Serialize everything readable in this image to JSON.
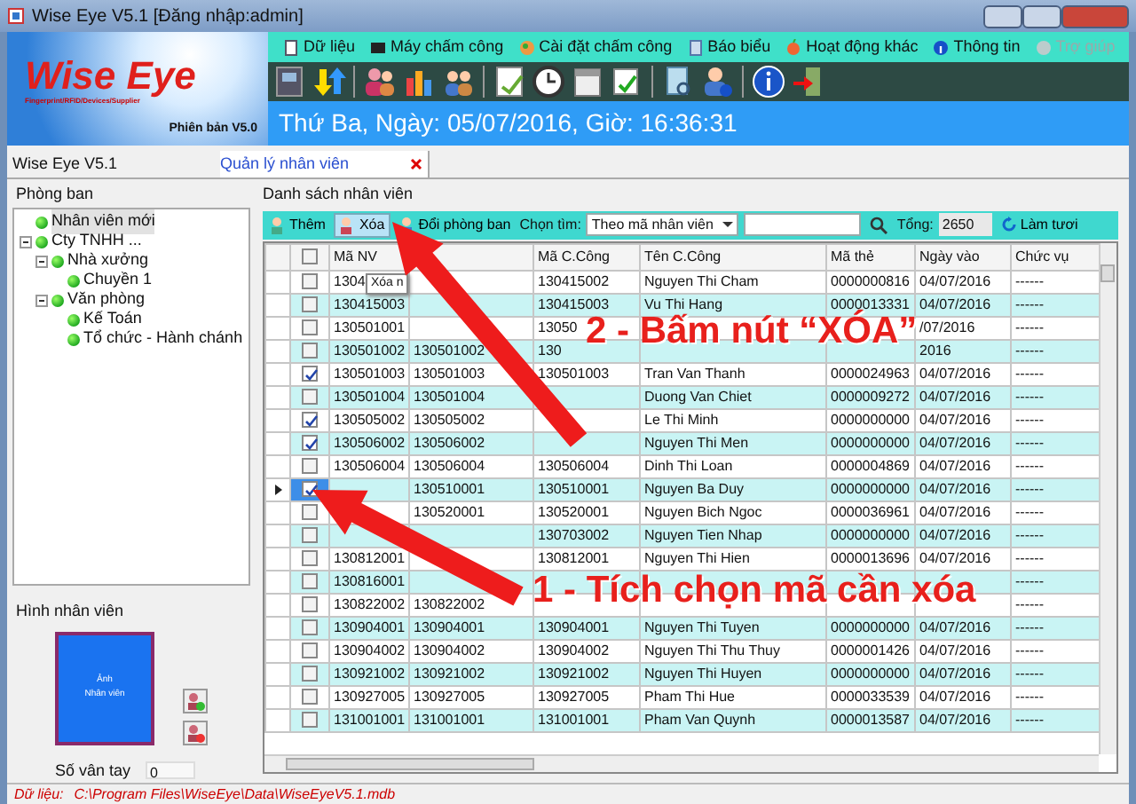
{
  "window": {
    "title": "Wise Eye V5.1 [Đăng nhập:admin]"
  },
  "logo": {
    "name": "Wise Eye",
    "tagline": "Fingerprint/RFID/Devices/Supplier",
    "version": "Phiên bản V5.0"
  },
  "menu": [
    {
      "label": "Dữ liệu",
      "disabled": false
    },
    {
      "label": "Máy chấm công",
      "disabled": false
    },
    {
      "label": "Cài đặt chấm công",
      "disabled": false
    },
    {
      "label": "Báo biểu",
      "disabled": false
    },
    {
      "label": "Hoạt động khác",
      "disabled": false
    },
    {
      "label": "Thông tin",
      "disabled": false
    },
    {
      "label": "Trợ giúp",
      "disabled": true
    }
  ],
  "date_bar": "Thứ Ba, Ngày: 05/07/2016, Giờ: 16:36:31",
  "app_label": "Wise Eye V5.1",
  "tabs": [
    {
      "label": "Quản lý nhân viên",
      "selected": true
    }
  ],
  "departments": {
    "title": "Phòng ban",
    "tree": [
      {
        "label": "Nhân viên mới",
        "selected": true
      },
      {
        "label": "Cty TNHH ...",
        "selected": false,
        "expanded": true,
        "children": [
          {
            "label": "Nhà xưởng",
            "selected": false,
            "expanded": true,
            "children": [
              {
                "label": "Chuyền 1",
                "selected": false
              }
            ]
          },
          {
            "label": "Văn phòng",
            "selected": false,
            "expanded": true,
            "children": [
              {
                "label": "Kế Toán",
                "selected": false
              },
              {
                "label": "Tổ chức - Hành chánh",
                "selected": false
              }
            ]
          }
        ]
      }
    ]
  },
  "photo": {
    "title": "Hình nhân viên",
    "caption": "Ảnh",
    "subcaption": "Nhân viên"
  },
  "fingerprints": {
    "label": "Số vân tay",
    "value": "0"
  },
  "list": {
    "title": "Danh sách nhân viên",
    "toolbar": {
      "add": "Thêm",
      "delete": "Xóa",
      "change_dept": "Đổi phòng ban",
      "search_label": "Chọn tìm:",
      "search_by": "Theo mã nhân viên",
      "total_label": "Tổng:",
      "total": "2650",
      "refresh": "Làm tươi"
    },
    "tooltip": "Xóa n",
    "select_all": false,
    "columns": [
      "Mã NV",
      null,
      "Mã C.Công",
      "Tên C.Công",
      "Mã thẻ",
      "Ngày vào",
      "Chức vụ"
    ],
    "rows": [
      {
        "cells": [
          "1304",
          null,
          "130415002",
          "Nguyen Thi Cham",
          "0000000816",
          "04/07/2016",
          "------"
        ],
        "checked": false,
        "current": false
      },
      {
        "cells": [
          "130415003",
          null,
          "130415003",
          "Vu Thi Hang",
          "0000013331",
          "04/07/2016",
          "------"
        ],
        "checked": false,
        "current": false
      },
      {
        "cells": [
          "130501001",
          null,
          "13050",
          null,
          null,
          "/07/2016",
          "------"
        ],
        "checked": false,
        "current": false
      },
      {
        "cells": [
          "130501002",
          "130501002",
          "130",
          null,
          null,
          "2016",
          "------"
        ],
        "checked": false,
        "current": false
      },
      {
        "cells": [
          "130501003",
          "130501003",
          "130501003",
          "Tran Van Thanh",
          "0000024963",
          "04/07/2016",
          "------"
        ],
        "checked": true,
        "current": false
      },
      {
        "cells": [
          "130501004",
          "130501004",
          null,
          "Duong Van Chiet",
          "0000009272",
          "04/07/2016",
          "------"
        ],
        "checked": false,
        "current": false
      },
      {
        "cells": [
          "130505002",
          "130505002",
          null,
          "Le Thi Minh",
          "0000000000",
          "04/07/2016",
          "------"
        ],
        "checked": true,
        "current": false
      },
      {
        "cells": [
          "130506002",
          "130506002",
          null,
          "Nguyen Thi Men",
          "0000000000",
          "04/07/2016",
          "------"
        ],
        "checked": true,
        "current": false
      },
      {
        "cells": [
          "130506004",
          "130506004",
          "130506004",
          "Dinh Thi Loan",
          "0000004869",
          "04/07/2016",
          "------"
        ],
        "checked": false,
        "current": false
      },
      {
        "cells": [
          null,
          "130510001",
          "130510001",
          "Nguyen Ba Duy",
          "0000000000",
          "04/07/2016",
          "------"
        ],
        "checked": true,
        "current": true
      },
      {
        "cells": [
          null,
          "130520001",
          "130520001",
          "Nguyen Bich Ngoc",
          "0000036961",
          "04/07/2016",
          "------"
        ],
        "checked": false,
        "current": false
      },
      {
        "cells": [
          null,
          null,
          "130703002",
          "Nguyen Tien Nhap",
          "0000000000",
          "04/07/2016",
          "------"
        ],
        "checked": false,
        "current": false
      },
      {
        "cells": [
          "130812001",
          null,
          "130812001",
          "Nguyen Thi Hien",
          "0000013696",
          "04/07/2016",
          "------"
        ],
        "checked": false,
        "current": false
      },
      {
        "cells": [
          "130816001",
          null,
          null,
          null,
          null,
          null,
          "------"
        ],
        "checked": false,
        "current": false
      },
      {
        "cells": [
          "130822002",
          "130822002",
          null,
          null,
          null,
          null,
          "------"
        ],
        "checked": false,
        "current": false
      },
      {
        "cells": [
          "130904001",
          "130904001",
          "130904001",
          "Nguyen Thi Tuyen",
          "0000000000",
          "04/07/2016",
          "------"
        ],
        "checked": false,
        "current": false
      },
      {
        "cells": [
          "130904002",
          "130904002",
          "130904002",
          "Nguyen Thi Thu Thuy",
          "0000001426",
          "04/07/2016",
          "------"
        ],
        "checked": false,
        "current": false
      },
      {
        "cells": [
          "130921002",
          "130921002",
          "130921002",
          "Nguyen Thi Huyen",
          "0000000000",
          "04/07/2016",
          "------"
        ],
        "checked": false,
        "current": false
      },
      {
        "cells": [
          "130927005",
          "130927005",
          "130927005",
          "Pham Thi Hue",
          "0000033539",
          "04/07/2016",
          "------"
        ],
        "checked": false,
        "current": false
      },
      {
        "cells": [
          "131001001",
          "131001001",
          "131001001",
          "Pham Van Quynh",
          "0000013587",
          "04/07/2016",
          "------"
        ],
        "checked": false,
        "current": false
      }
    ]
  },
  "status_bar": {
    "label": "Dữ liệu:",
    "path": "C:\\Program Files\\WiseEye\\Data\\WiseEyeV5.1.mdb"
  },
  "annotations": [
    {
      "text": "2 - Bấm nút “XÓA”"
    },
    {
      "text": "1 - Tích chọn mã cần xóa"
    }
  ]
}
